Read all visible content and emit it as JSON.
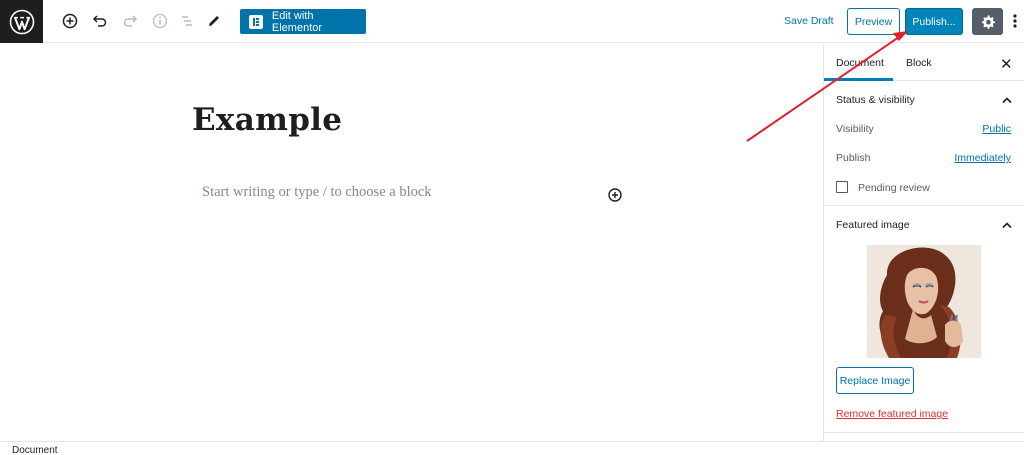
{
  "toolbar": {
    "logo_icon": "wordpress-icon",
    "icons": [
      "add-block-icon",
      "undo-icon",
      "redo-icon",
      "info-icon",
      "outline-icon",
      "edit-pencil-icon"
    ],
    "elementor_label": "Edit with Elementor",
    "save_draft_label": "Save Draft",
    "preview_label": "Preview",
    "publish_label": "Publish...",
    "settings_icon": "gear-icon",
    "more_icon": "more-vertical-icon"
  },
  "editor": {
    "title": "Example",
    "placeholder": "Start writing or type / to choose a block",
    "inserter_icon": "add-block-icon"
  },
  "sidebar": {
    "tabs": [
      {
        "label": "Document",
        "active": true
      },
      {
        "label": "Block",
        "active": false
      }
    ],
    "close_label": "✕",
    "status_panel": {
      "title": "Status & visibility",
      "visibility_label": "Visibility",
      "visibility_value": "Public",
      "publish_label": "Publish",
      "publish_value": "Immediately",
      "pending_review_label": "Pending review",
      "pending_review_checked": false
    },
    "featured_panel": {
      "title": "Featured image",
      "replace_label": "Replace Image",
      "remove_label": "Remove featured image"
    }
  },
  "footer": {
    "breadcrumb": "Document"
  },
  "colors": {
    "accent": "#0073aa",
    "publish": "#0085ba",
    "danger": "#dc3232",
    "annotation_arrow": "#e0202a"
  }
}
